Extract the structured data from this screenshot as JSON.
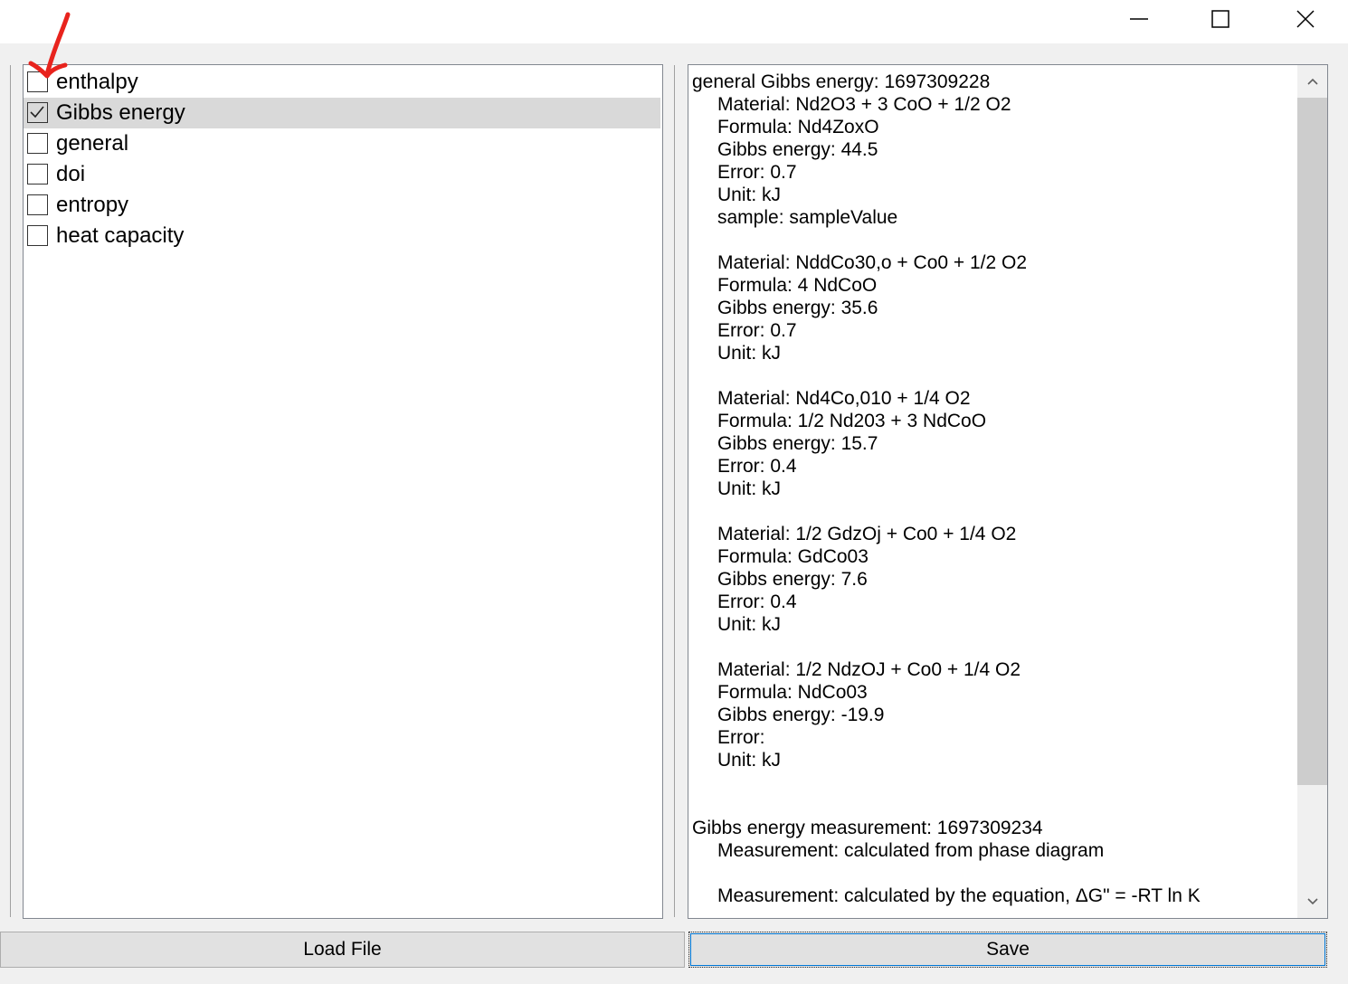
{
  "window": {
    "minimize_icon": "minimize-icon",
    "maximize_icon": "maximize-icon",
    "close_icon": "close-icon"
  },
  "fields": {
    "items": [
      {
        "label": "enthalpy",
        "checked": false,
        "selected": false
      },
      {
        "label": "Gibbs energy",
        "checked": true,
        "selected": true
      },
      {
        "label": "general",
        "checked": false,
        "selected": false
      },
      {
        "label": "doi",
        "checked": false,
        "selected": false
      },
      {
        "label": "entropy",
        "checked": false,
        "selected": false
      },
      {
        "label": "heat capacity",
        "checked": false,
        "selected": false
      }
    ]
  },
  "output": {
    "lines": [
      {
        "text": "general Gibbs energy: 1697309228",
        "indent": false
      },
      {
        "text": "Material: Nd2O3 + 3 CoO + 1/2 O2",
        "indent": true
      },
      {
        "text": "Formula: Nd4ZoxO",
        "indent": true
      },
      {
        "text": "Gibbs energy: 44.5",
        "indent": true
      },
      {
        "text": "Error: 0.7",
        "indent": true
      },
      {
        "text": "Unit: kJ",
        "indent": true
      },
      {
        "text": "sample: sampleValue",
        "indent": true
      },
      {
        "text": "",
        "indent": true
      },
      {
        "text": "Material: NddCo30,o + Co0 + 1/2 O2",
        "indent": true
      },
      {
        "text": "Formula: 4 NdCoO",
        "indent": true
      },
      {
        "text": "Gibbs energy: 35.6",
        "indent": true
      },
      {
        "text": "Error: 0.7",
        "indent": true
      },
      {
        "text": "Unit: kJ",
        "indent": true
      },
      {
        "text": "",
        "indent": true
      },
      {
        "text": "Material: Nd4Co,010 + 1/4 O2",
        "indent": true
      },
      {
        "text": "Formula: 1/2 Nd203 + 3 NdCoO",
        "indent": true
      },
      {
        "text": "Gibbs energy: 15.7",
        "indent": true
      },
      {
        "text": "Error: 0.4",
        "indent": true
      },
      {
        "text": "Unit: kJ",
        "indent": true
      },
      {
        "text": "",
        "indent": true
      },
      {
        "text": "Material: 1/2 GdzOj + Co0 + 1/4 O2",
        "indent": true
      },
      {
        "text": "Formula: GdCo03",
        "indent": true
      },
      {
        "text": "Gibbs energy: 7.6",
        "indent": true
      },
      {
        "text": "Error: 0.4",
        "indent": true
      },
      {
        "text": "Unit: kJ",
        "indent": true
      },
      {
        "text": "",
        "indent": true
      },
      {
        "text": "Material: 1/2 NdzOJ + Co0 + 1/4 O2",
        "indent": true
      },
      {
        "text": "Formula: NdCo03",
        "indent": true
      },
      {
        "text": "Gibbs energy: -19.9",
        "indent": true
      },
      {
        "text": "Error:",
        "indent": true
      },
      {
        "text": "Unit: kJ",
        "indent": true
      },
      {
        "text": "",
        "indent": true
      },
      {
        "text": "",
        "indent": true
      },
      {
        "text": "Gibbs energy measurement: 1697309234",
        "indent": false
      },
      {
        "text": "Measurement: calculated from phase diagram",
        "indent": true
      },
      {
        "text": "",
        "indent": true
      },
      {
        "text": "Measurement: calculated by the equation, ΔG\" = -RT ln K",
        "indent": true
      }
    ]
  },
  "buttons": {
    "load_label": "Load File",
    "save_label": "Save"
  },
  "colors": {
    "annotation": "#e8231d",
    "selection": "#d9d9d9",
    "scroll_thumb": "#cdcdcd"
  },
  "scroll": {
    "position_fraction": 0.0
  }
}
